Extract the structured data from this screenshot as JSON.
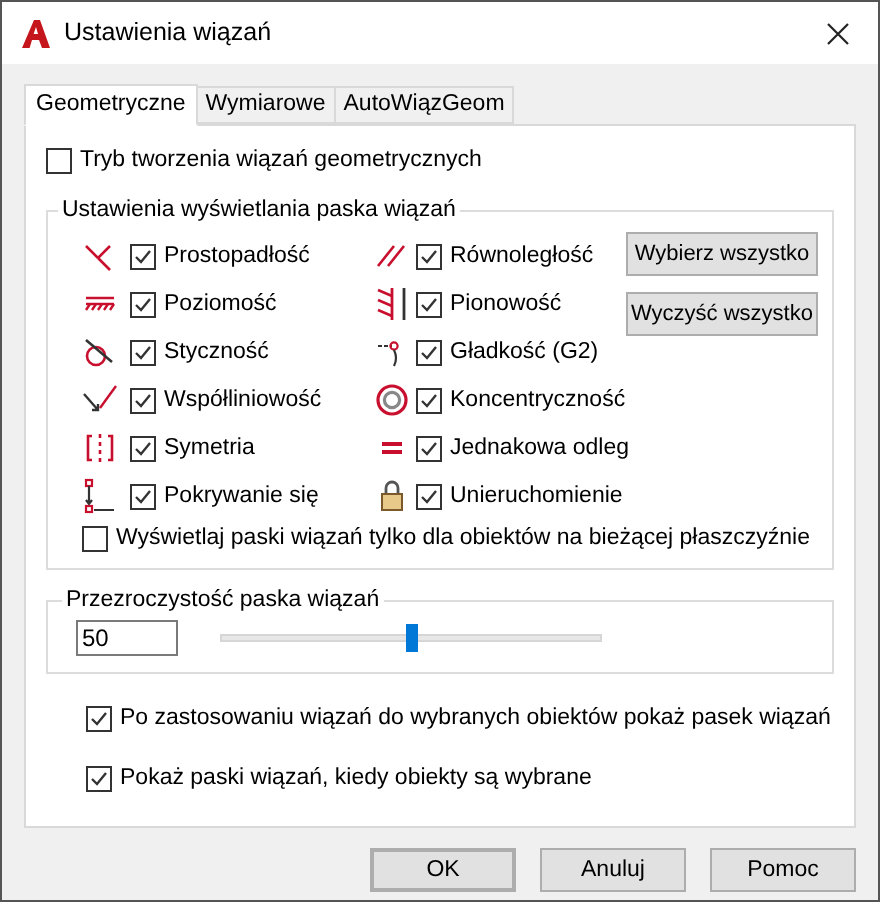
{
  "window": {
    "title": "Ustawienia wiązań"
  },
  "tabs": [
    {
      "label": "Geometryczne",
      "selected": true
    },
    {
      "label": "Wymiarowe",
      "selected": false
    },
    {
      "label": "AutoWiązGeom",
      "selected": false
    }
  ],
  "creation_mode": {
    "label": "Tryb tworzenia wiązań geometrycznych",
    "checked": false
  },
  "display_group": {
    "title": "Ustawienia wyświetlania paska wiązań",
    "left_constraints": [
      {
        "label": "Prostopadłość",
        "checked": true
      },
      {
        "label": "Poziomość",
        "checked": true
      },
      {
        "label": "Styczność",
        "checked": true
      },
      {
        "label": "Współliniowość",
        "checked": true
      },
      {
        "label": "Symetria",
        "checked": true
      },
      {
        "label": "Pokrywanie się",
        "checked": true
      }
    ],
    "right_constraints": [
      {
        "label": "Równoległość",
        "checked": true
      },
      {
        "label": "Pionowość",
        "checked": true
      },
      {
        "label": "Gładkość (G2)",
        "checked": true
      },
      {
        "label": "Koncentryczność",
        "checked": true
      },
      {
        "label": "Jednakowa odleg",
        "checked": true
      },
      {
        "label": "Unieruchomienie",
        "checked": true
      }
    ],
    "buttons": [
      "Wybierz wszystko",
      "Wyczyść wszystko"
    ],
    "current_plane_only": {
      "label": "Wyświetlaj paski wiązań tylko dla obiektów na bieżącej płaszczyźnie",
      "checked": false
    }
  },
  "transparency_group": {
    "title": "Przezroczystość paska wiązań",
    "value": "50",
    "level": 0.5
  },
  "options": [
    {
      "label": "Po zastosowaniu wiązań do wybranych obiektów pokaż pasek wiązań",
      "checked": true
    },
    {
      "label": "Pokaż paski wiązań, kiedy obiekty są wybrane",
      "checked": true
    }
  ],
  "buttons": [
    {
      "label": "OK",
      "default": true
    },
    {
      "label": "Anuluj",
      "default": false
    },
    {
      "label": "Pomoc",
      "default": false
    }
  ]
}
